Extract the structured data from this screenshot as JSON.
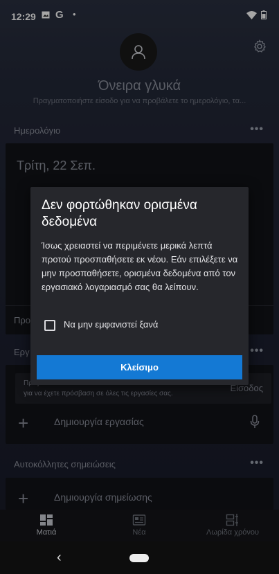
{
  "status_bar": {
    "time": "12:29",
    "left_icons": [
      "image-icon",
      "google-icon",
      "dot-icon"
    ],
    "google_glyph": "G",
    "right_icons": [
      "wifi-icon",
      "battery-icon"
    ]
  },
  "header": {
    "greeting": "Όνειρα γλυκά",
    "subtext": "Πραγματοποιήστε είσοδο για να προβάλετε το ημερολόγιο, τα...",
    "avatar_icon": "person-icon",
    "settings_icon": "gear-icon"
  },
  "calendar": {
    "title": "Ημερολόγιο",
    "more": "•••",
    "date": "Τρίτη, 22 Σεπ.",
    "bottom_label": "Προ"
  },
  "tasks": {
    "title": "Εργ",
    "more": "•••",
    "banner_line1": "Πραγ",
    "banner_line2": "για να έχετε πρόσβαση σε όλες τις εργασίες σας.",
    "signin": "Είσοδος",
    "add_plus": "+",
    "add_label": "Δημιουργία εργασίας"
  },
  "notes": {
    "title": "Αυτοκόλλητες σημειώσεις",
    "more": "•••",
    "add_plus": "+",
    "add_label": "Δημιουργία σημείωσης"
  },
  "bottom_nav": {
    "items": [
      {
        "label": "Ματιά",
        "icon": "dashboard-icon",
        "active": true
      },
      {
        "label": "Νέα",
        "icon": "news-icon",
        "active": false
      },
      {
        "label": "Λωρίδα χρόνου",
        "icon": "timeline-icon",
        "active": false
      }
    ]
  },
  "system_nav": {
    "back": "‹"
  },
  "dialog": {
    "title": "Δεν φορτώθηκαν ορισμένα δεδομένα",
    "body": "Ίσως χρειαστεί να περιμένετε μερικά λεπτά προτού προσπαθήσετε εκ νέου. Εάν επιλέξετε να μην προσπαθήσετε, ορισμένα δεδομένα από τον εργασιακό λογαριασμό σας θα λείπουν.",
    "checkbox_label": "Να μην εμφανιστεί ξανά",
    "checkbox_checked": false,
    "button_label": "Κλείσιμο",
    "button_color": "#1479d4"
  }
}
